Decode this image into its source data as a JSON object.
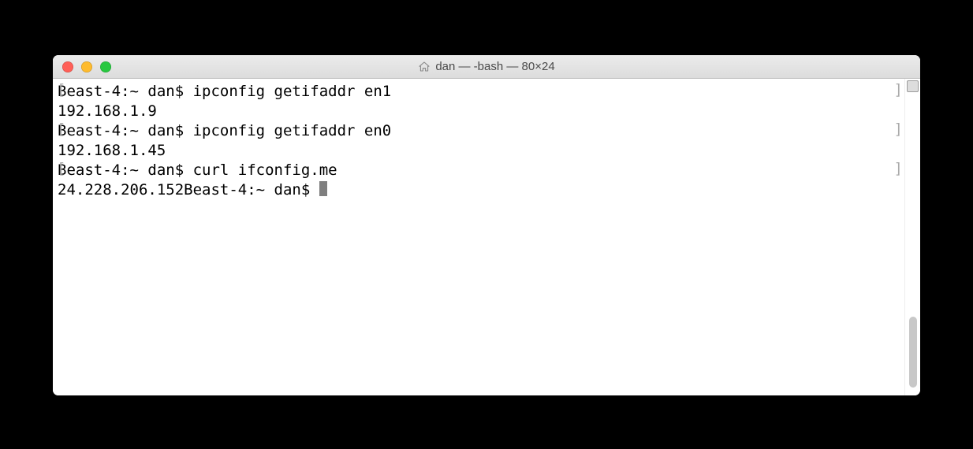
{
  "window": {
    "title": "dan — -bash — 80×24"
  },
  "terminal": {
    "lines": [
      {
        "prompt": "Beast-4:~ dan$ ",
        "command": "ipconfig getifaddr en1"
      },
      {
        "output": "192.168.1.9"
      },
      {
        "prompt": "Beast-4:~ dan$ ",
        "command": "ipconfig getifaddr en0"
      },
      {
        "output": "192.168.1.45"
      },
      {
        "prompt": "Beast-4:~ dan$ ",
        "command": "curl ifconfig.me"
      },
      {
        "output_inline": "24.228.206.152",
        "prompt": "Beast-4:~ dan$ ",
        "cursor": true
      }
    ]
  }
}
